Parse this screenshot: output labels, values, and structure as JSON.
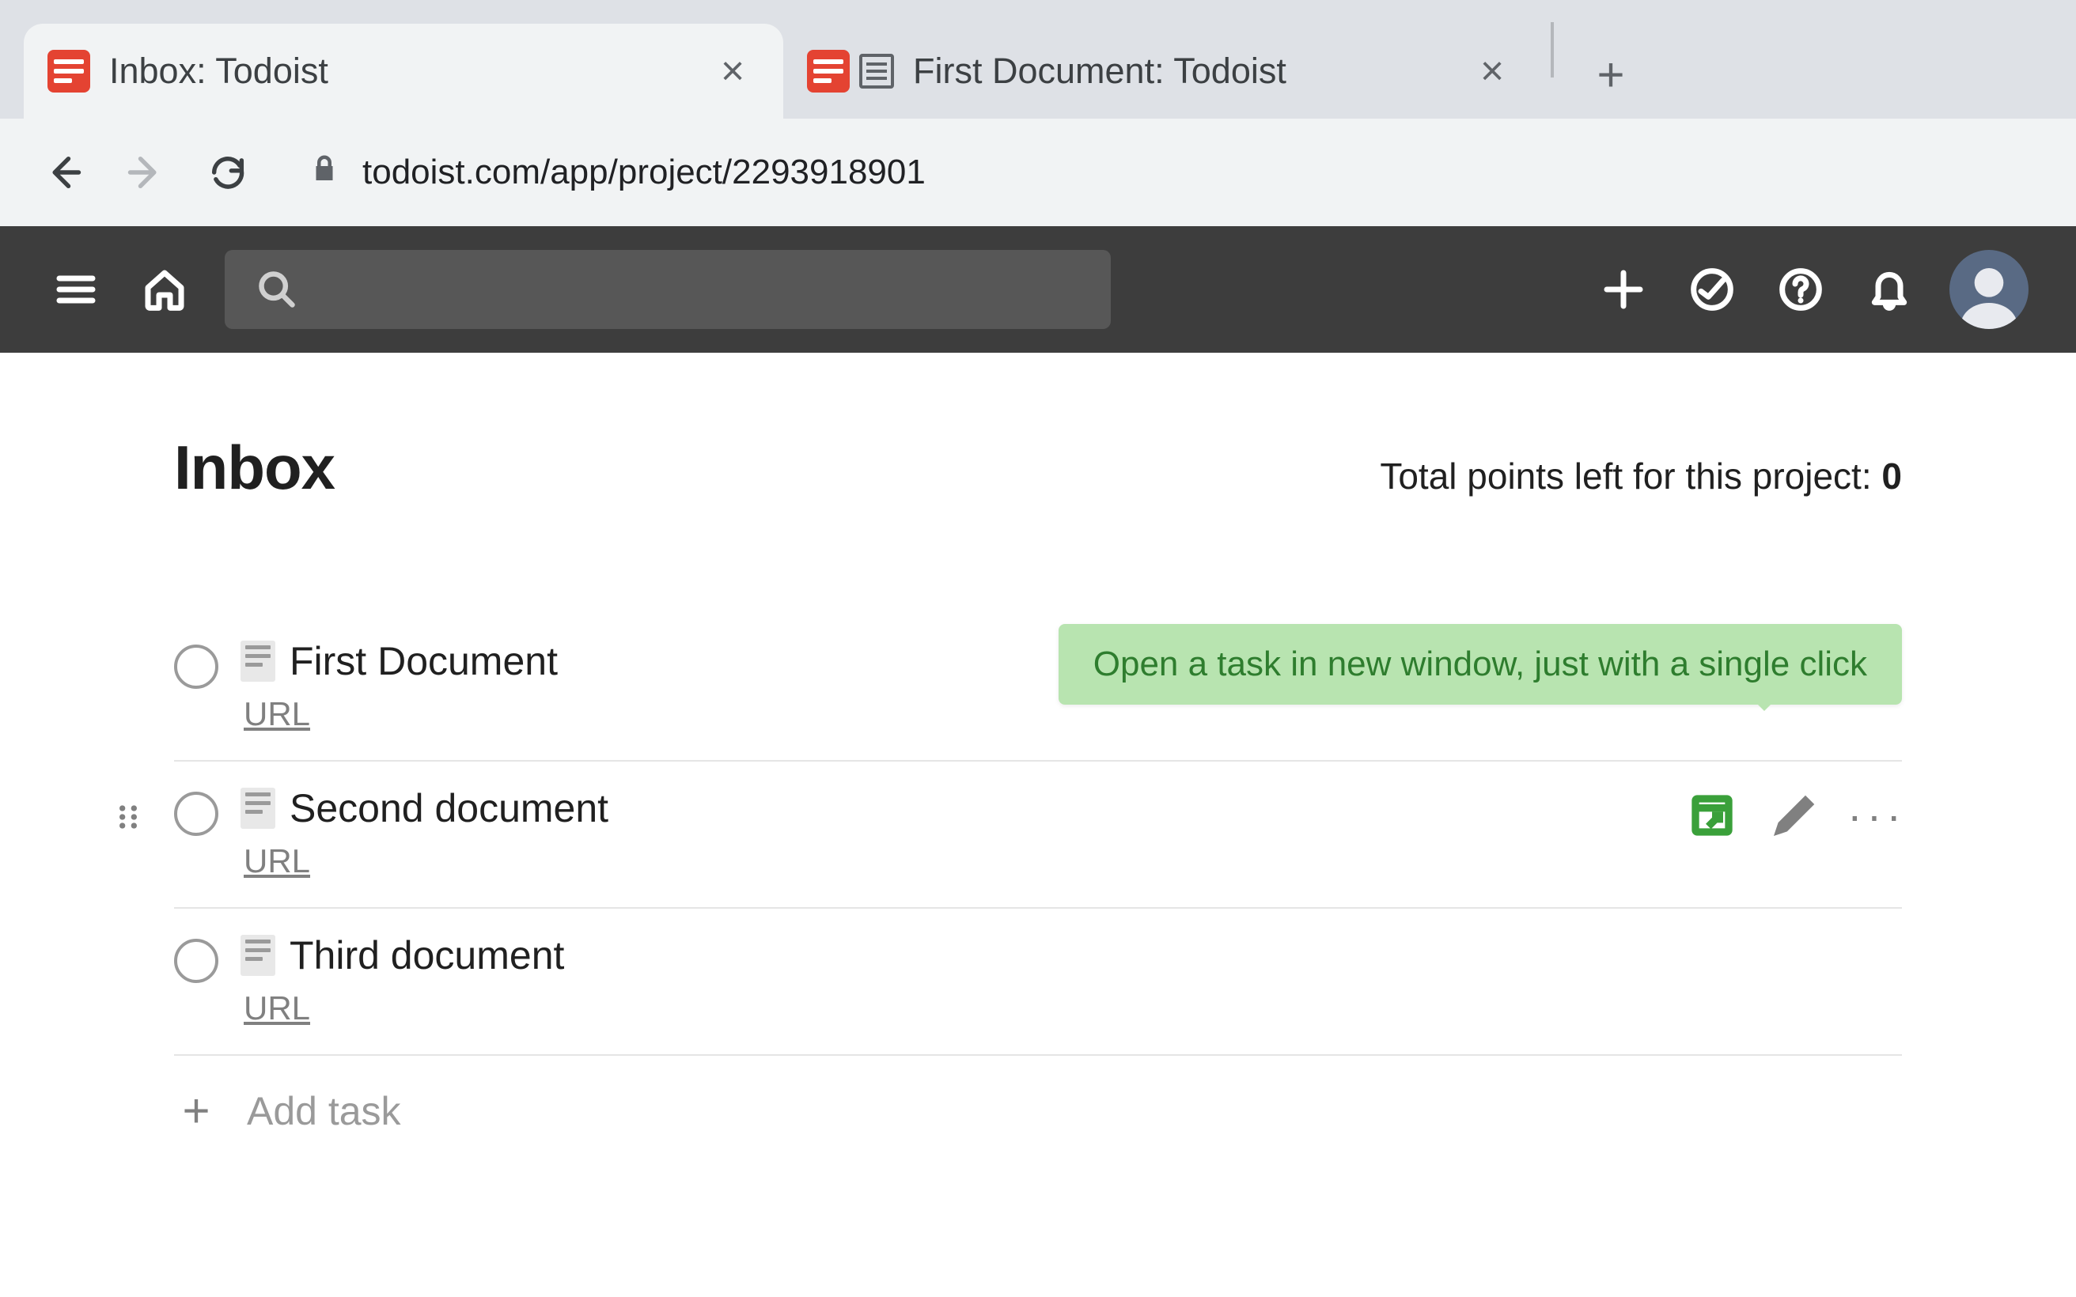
{
  "browser": {
    "tabs": [
      {
        "title": "Inbox: Todoist",
        "active": true,
        "has_doc_icon": false
      },
      {
        "title": "First Document: Todoist",
        "active": false,
        "has_doc_icon": true
      }
    ],
    "url": "todoist.com/app/project/2293918901"
  },
  "header": {
    "icons": {
      "menu": "menu-icon",
      "home": "home-icon",
      "search": "search-icon",
      "add": "plus-icon",
      "productivity": "productivity-icon",
      "help": "help-icon",
      "notifications": "bell-icon",
      "avatar": "avatar-icon"
    }
  },
  "main": {
    "title": "Inbox",
    "points_label": "Total points left for this project: ",
    "points_value": "0",
    "tooltip": "Open a task in new window, just with a single click",
    "tasks": [
      {
        "title": "First Document",
        "sub": "URL",
        "hovered": false
      },
      {
        "title": "Second document",
        "sub": "URL",
        "hovered": true
      },
      {
        "title": "Third document",
        "sub": "URL",
        "hovered": false
      }
    ],
    "add_task_label": "Add task"
  }
}
